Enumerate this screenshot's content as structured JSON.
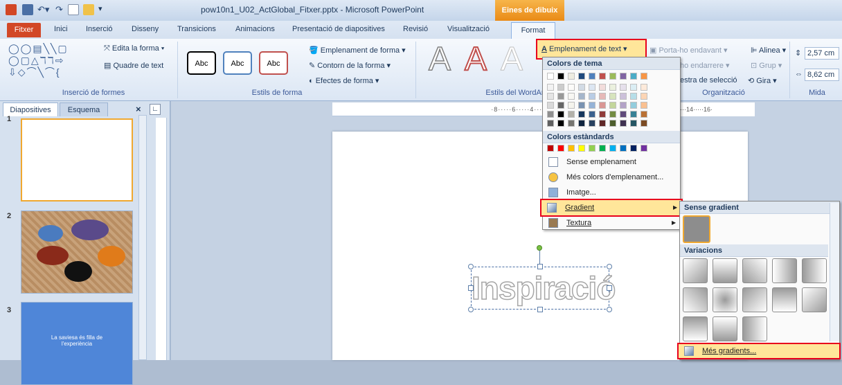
{
  "window": {
    "title": "pow10n1_U02_ActGlobal_Fitxer.pptx - Microsoft PowerPoint",
    "context_tab": "Eines de dibuix"
  },
  "tabs": [
    "Fitxer",
    "Inici",
    "Inserció",
    "Disseny",
    "Transicions",
    "Animacions",
    "Presentació de diapositives",
    "Revisió",
    "Visualització",
    "Format"
  ],
  "ribbon": {
    "insert_shapes": {
      "edit_shape": "Edita la forma",
      "text_box": "Quadre de text",
      "label": "Inserció de formes"
    },
    "shape_styles": {
      "abc": "Abc",
      "fill": "Emplenament de forma",
      "outline": "Contorn de la forma",
      "effects": "Efectes de forma",
      "label": "Estils de forma"
    },
    "wordart": {
      "letter": "A",
      "label": "Estils del WordArt"
    },
    "arrange": {
      "bring_forward": "Porta-ho endavant",
      "send_backward": "ho endarrere",
      "selection_pane": "estra de selecció",
      "align": "Alinea",
      "group": "Grup",
      "rotate": "Gira",
      "label": "Organització"
    },
    "size": {
      "height": "2,57 cm",
      "width": "8,62 cm",
      "label": "Mida"
    },
    "text_fill": "Emplenament de text"
  },
  "left_pane": {
    "tab_slides": "Diapositives",
    "tab_outline": "Esquema",
    "close": "×",
    "slide_numbers": [
      "1",
      "2",
      "3"
    ],
    "slide3_text": "La saviesa és filla de l'experiència"
  },
  "ruler_top": "·8·····6·····4·····2···· ···2·····4",
  "ruler_top_right": "···14·····16·",
  "slide": {
    "wordart_text": "Inspiració"
  },
  "menu": {
    "theme_colors": "Colors de tema",
    "standard_colors": "Colors estàndards",
    "no_fill": "Sense emplenament",
    "more_colors": "Més colors d'emplenament...",
    "image": "Imatge...",
    "gradient": "Gradient",
    "texture": "Textura",
    "theme_top_row": [
      "#ffffff",
      "#000000",
      "#eeece1",
      "#1f497d",
      "#4f81bd",
      "#c0504d",
      "#9bbb59",
      "#8064a2",
      "#4bacc6",
      "#f79646"
    ],
    "standard_row": [
      "#c00000",
      "#ff0000",
      "#ffc000",
      "#ffff00",
      "#92d050",
      "#00b050",
      "#00b0f0",
      "#0070c0",
      "#002060",
      "#7030a0"
    ]
  },
  "submenu": {
    "no_gradient": "Sense gradient",
    "variations": "Variacions",
    "more_gradients": "Més gradients..."
  }
}
